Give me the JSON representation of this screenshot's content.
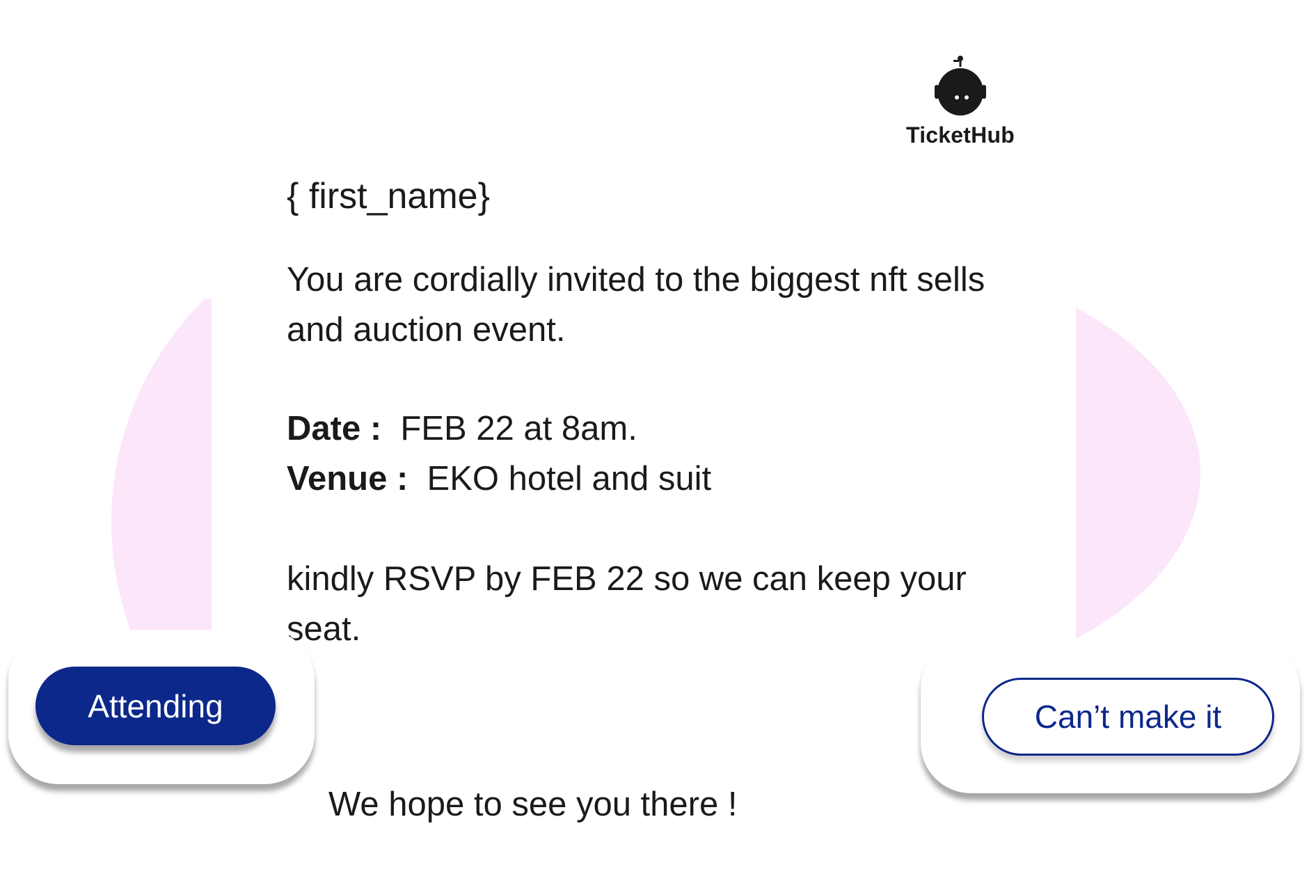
{
  "brand": {
    "name": "TicketHub",
    "logo_icon": "robot-head-icon"
  },
  "email": {
    "greeting": "{ first_name}",
    "message": "You are cordially invited to the biggest nft sells and auction event.",
    "date_label": "Date :",
    "date_value": "FEB 22 at 8am.",
    "venue_label": "Venue :",
    "venue_value": "EKO hotel and suit",
    "rsvp_note": "kindly RSVP by FEB 22 so we can keep your seat.",
    "closing": "We hope to see you there !"
  },
  "actions": {
    "attending_label": "Attending",
    "decline_label": "Can’t make it"
  },
  "colors": {
    "primary": "#0d288b",
    "background_blob": "#fce6fa",
    "text": "#1a1a1a"
  }
}
